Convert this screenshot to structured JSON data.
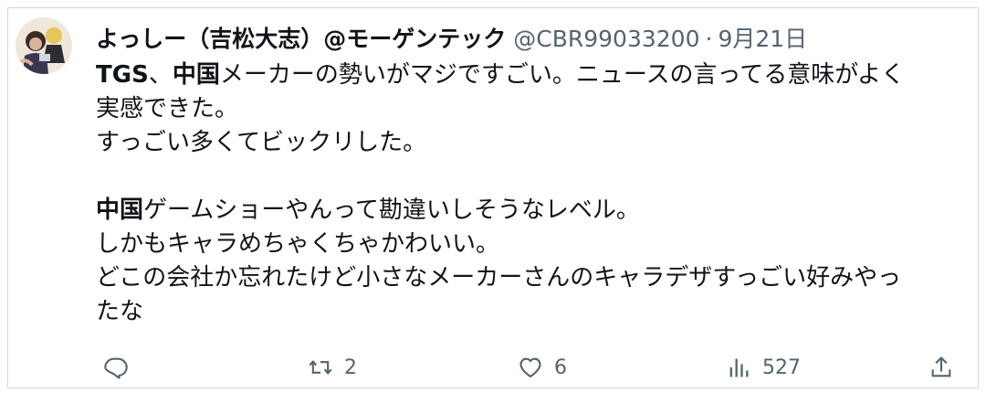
{
  "tweet": {
    "display_name": "よっしー（吉松大志）@モーゲンテック",
    "handle": "@CBR99033200",
    "separator": "·",
    "date": "9月21日",
    "body": {
      "line1_bold_a": "TGS",
      "line1_plain_a": "、",
      "line1_bold_b": "中国",
      "line1_plain_b": "メーカーの勢いがマジですごい。ニュースの言ってる意味がよく",
      "line2": "実感できた。",
      "line3": "すっごい多くてビックリした。",
      "line5_bold": "中国",
      "line5_plain": "ゲームショーやんって勘違いしそうなレベル。",
      "line6": "しかもキャラめちゃくちゃかわいい。",
      "line7": "どこの会社か忘れたけど小さなメーカーさんのキャラデザすっごい好みやっ",
      "line8": "たな"
    },
    "actions": {
      "reply_count": "",
      "retweet_count": "2",
      "like_count": "6",
      "view_count": "527"
    },
    "icons": {
      "reply": "reply-icon",
      "retweet": "retweet-icon",
      "like": "heart-icon",
      "views": "views-icon",
      "share": "share-icon"
    },
    "colors": {
      "text": "#0f1419",
      "secondary": "#536471",
      "border": "#cfd9de"
    }
  }
}
